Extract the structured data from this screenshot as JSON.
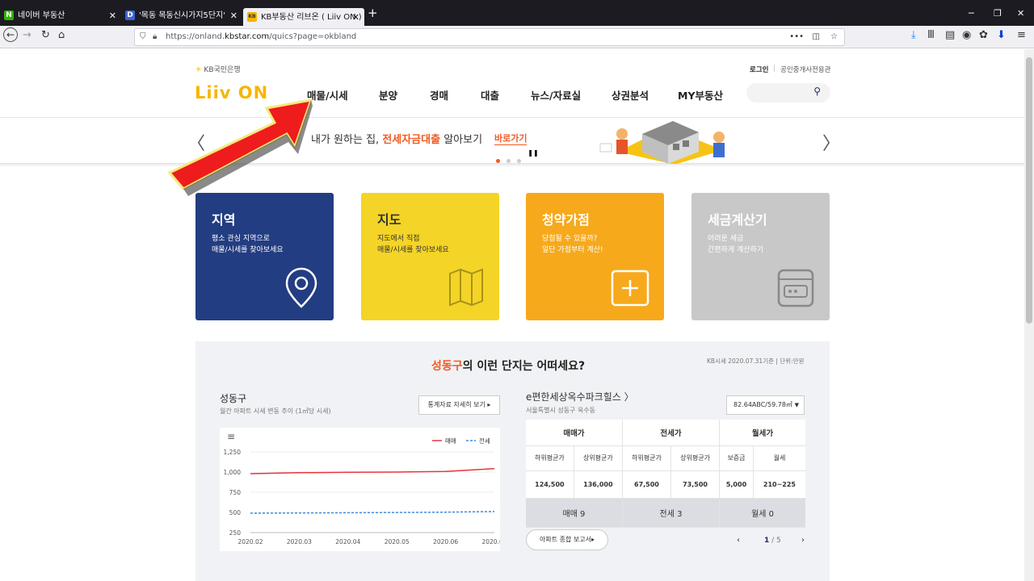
{
  "browser": {
    "tabs": [
      {
        "label": "네이버 부동산",
        "favicon": "N"
      },
      {
        "label": "'목동 목동신시가지5단지' 실거",
        "favicon": "D"
      },
      {
        "label": "KB부동산 리브온 ( Liiv ON )",
        "favicon": "KB"
      }
    ],
    "url_prefix": "https://onland.",
    "url_domain": "kbstar.com",
    "url_suffix": "/quics?page=okbland"
  },
  "header": {
    "bank_name": "KB국민은행",
    "logo_text": "Liiv ON",
    "login": "로그인",
    "agent_link": "공인중개사전용관",
    "nav": [
      "매물/시세",
      "분양",
      "경매",
      "대출",
      "뉴스/자료실",
      "상권분석",
      "MY부동산"
    ]
  },
  "banner": {
    "text_before": "내가 원하는 집, ",
    "highlight": "전세자금대출",
    "text_after": " 알아보기",
    "link": "바로가기"
  },
  "cards": [
    {
      "title": "지역",
      "desc1": "평소 관심 지역으로",
      "desc2": "매물/시세를 찾아보세요",
      "icon": "location-pin-icon",
      "color": "#233d82"
    },
    {
      "title": "지도",
      "desc1": "지도에서 직접",
      "desc2": "매물/시세를 찾아보세요",
      "icon": "map-icon",
      "color": "#f4d426"
    },
    {
      "title": "청약가점",
      "desc1": "당첨될 수 있을까?",
      "desc2": "일단 가점부터 계산!",
      "icon": "plus-icon",
      "color": "#f7a91c"
    },
    {
      "title": "세금계산기",
      "desc1": "어려운 세금",
      "desc2": "간편하게 계산하기",
      "icon": "calculator-icon",
      "color": "#c8c8c8"
    }
  ],
  "section": {
    "title_highlight": "성동구",
    "title_rest": "의 이런 단지는 어떠세요?",
    "basis": "KB시세 2020.07.31기준 | 단위:만원",
    "chart": {
      "region": "성동구",
      "subtitle": "월간 아파트 시세 변동 추이 (1㎡당 시세)",
      "detail_button": "통계자료 자세히 보기",
      "legend_sale": "매매",
      "legend_jeonse": "전세"
    },
    "complex": {
      "name": "e편한세상옥수파크힐스",
      "address": "서울특별시 성동구 옥수동",
      "area_select": "82.64ABC/59.78㎡",
      "groups": [
        "매매가",
        "전세가",
        "월세가"
      ],
      "subheaders": [
        "하위평균가",
        "상위평균가",
        "하위평균가",
        "상위평균가",
        "보증금",
        "월세"
      ],
      "values": [
        "124,500",
        "136,000",
        "67,500",
        "73,500",
        "5,000",
        "210~225"
      ],
      "counts": [
        "매매 9",
        "전세 3",
        "월세 0"
      ],
      "report_button": "아파트 종합 보고서",
      "pagination_current": "1",
      "pagination_total": " / 5"
    }
  },
  "chart_data": {
    "type": "line",
    "x": [
      "2020.02",
      "2020.03",
      "2020.04",
      "2020.05",
      "2020.06",
      "2020.07"
    ],
    "series": [
      {
        "name": "매매",
        "values": [
          980,
          992,
          998,
          1000,
          1008,
          1042
        ],
        "color": "#e8353f"
      },
      {
        "name": "전세",
        "values": [
          490,
          493,
          496,
          499,
          503,
          512
        ],
        "color": "#3f8ee0"
      }
    ],
    "y_ticks": [
      "250",
      "500",
      "750",
      "1,000",
      "1,250"
    ],
    "ylim": [
      250,
      1250
    ],
    "legend": "top-right"
  }
}
